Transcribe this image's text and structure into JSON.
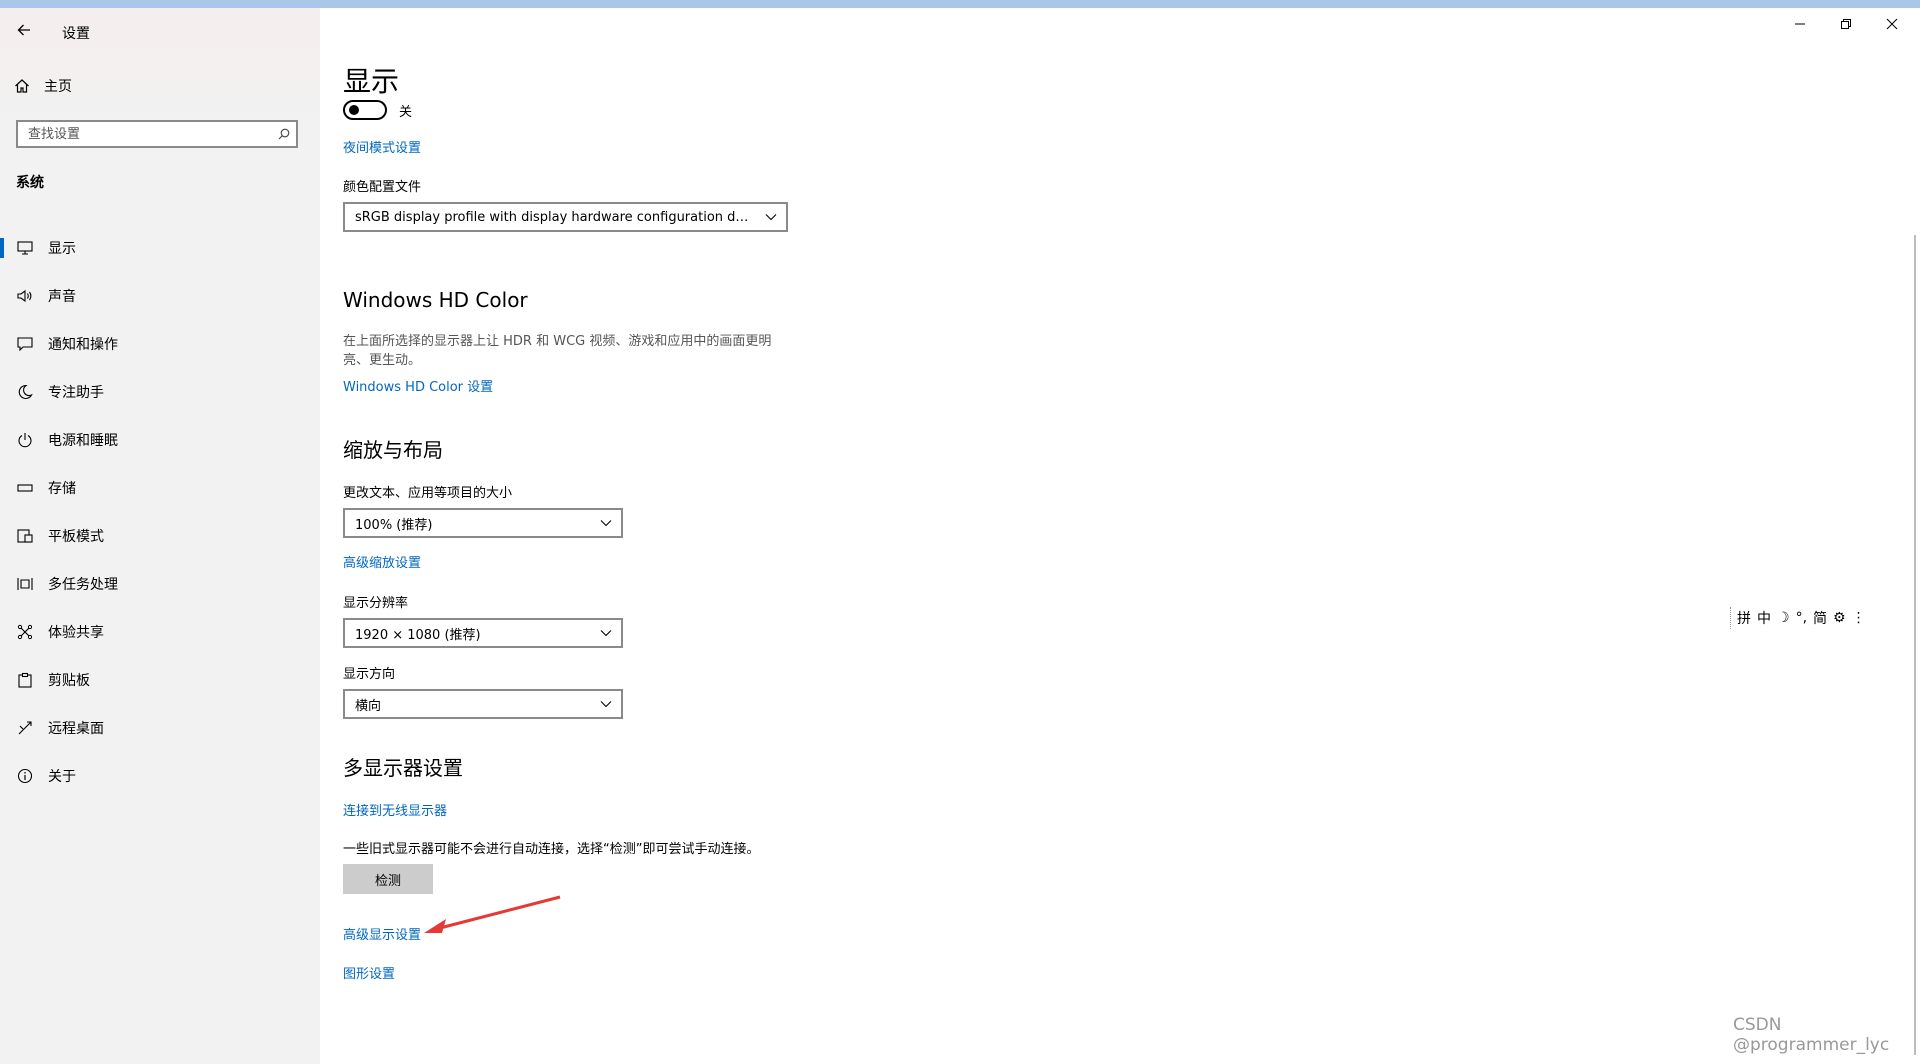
{
  "window": {
    "title": "设置"
  },
  "sidebar": {
    "home_label": "主页",
    "search_placeholder": "查找设置",
    "section_label": "系统",
    "items": [
      {
        "label": "显示",
        "icon": "monitor-icon",
        "active": true
      },
      {
        "label": "声音",
        "icon": "speaker-icon"
      },
      {
        "label": "通知和操作",
        "icon": "notification-icon"
      },
      {
        "label": "专注助手",
        "icon": "moon-icon"
      },
      {
        "label": "电源和睡眠",
        "icon": "power-icon"
      },
      {
        "label": "存储",
        "icon": "storage-icon"
      },
      {
        "label": "平板模式",
        "icon": "tablet-icon"
      },
      {
        "label": "多任务处理",
        "icon": "multitask-icon"
      },
      {
        "label": "体验共享",
        "icon": "share-icon"
      },
      {
        "label": "剪贴板",
        "icon": "clipboard-icon"
      },
      {
        "label": "远程桌面",
        "icon": "remote-desktop-icon"
      },
      {
        "label": "关于",
        "icon": "info-icon"
      }
    ]
  },
  "main": {
    "title": "显示",
    "night_light": {
      "toggle_state": "关",
      "settings_link": "夜间模式设置"
    },
    "color_profile": {
      "label": "颜色配置文件",
      "value": "sRGB display profile with display hardware configuration data d..."
    },
    "hd_color": {
      "heading": "Windows HD Color",
      "description": "在上面所选择的显示器上让 HDR 和 WCG 视频、游戏和应用中的画面更明亮、更生动。",
      "link": "Windows HD Color 设置"
    },
    "scale_layout": {
      "heading": "缩放与布局",
      "scale_label": "更改文本、应用等项目的大小",
      "scale_value": "100% (推荐)",
      "advanced_scaling_link": "高级缩放设置",
      "resolution_label": "显示分辨率",
      "resolution_value": "1920 × 1080 (推荐)",
      "orientation_label": "显示方向",
      "orientation_value": "横向"
    },
    "multi_display": {
      "heading": "多显示器设置",
      "wireless_link": "连接到无线显示器",
      "detect_description": "一些旧式显示器可能不会进行自动连接，选择“检测”即可尝试手动连接。",
      "detect_button": "检测",
      "advanced_display_link": "高级显示设置",
      "graphics_link": "图形设置"
    }
  },
  "ime_toolbar": [
    "拼",
    "中",
    "☽",
    "°,",
    "简",
    "⚙",
    "⋮"
  ],
  "watermark": "CSDN @programmer_lyc",
  "colors": {
    "accent": "#0067c0",
    "annotation_arrow": "#e53935"
  }
}
